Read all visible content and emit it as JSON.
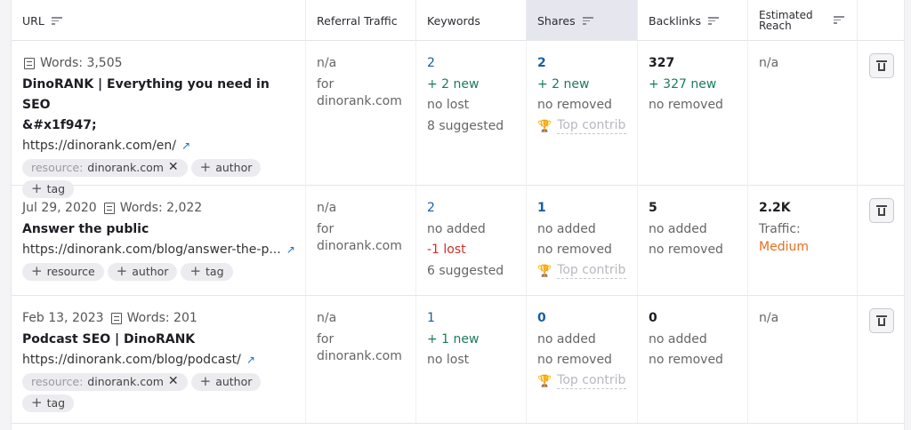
{
  "header": {
    "url": "URL",
    "referral": "Referral Traffic",
    "keywords": "Keywords",
    "shares": "Shares",
    "backlinks": "Backlinks",
    "reach_l1": "Estimated",
    "reach_l2": "Reach"
  },
  "rows": [
    {
      "date": "",
      "words": "Words: 3,505",
      "title": "DinoRANK | Everything you need in SEO",
      "title_l2": "&#x1f947;",
      "url": "https://dinorank.com/en/",
      "referral": [
        "n/a",
        "for",
        "dinorank.com"
      ],
      "keywords": [
        "2",
        "+ 2 new",
        "no lost",
        "8 suggested"
      ],
      "shares": [
        "2",
        "+ 2 new",
        "no removed"
      ],
      "top_contrib": "Top contributors",
      "backlinks": [
        "327",
        "+ 327 new",
        "no removed"
      ],
      "reach": "n/a"
    },
    {
      "date": "Jul 29, 2020",
      "words": "Words: 2,022",
      "title": "Answer the public",
      "url": "https://dinorank.com/blog/answer-the-p...",
      "referral": [
        "n/a",
        "for",
        "dinorank.com"
      ],
      "keywords": [
        "2",
        "no added",
        "-1 lost",
        "6 suggested"
      ],
      "shares": [
        "1",
        "no added",
        "no removed"
      ],
      "top_contrib": "Top contributors",
      "backlinks": [
        "5",
        "no added",
        "no removed"
      ],
      "reach": "2.2K",
      "reach_traffic": "Traffic:",
      "reach_level": "Medium"
    },
    {
      "date": "Feb 13, 2023",
      "words": "Words: 201",
      "title": "Podcast SEO | DinoRANK",
      "url": "https://dinorank.com/blog/podcast/",
      "referral": [
        "n/a",
        "for",
        "dinorank.com"
      ],
      "keywords": [
        "1",
        "+ 1 new",
        "no lost"
      ],
      "shares": [
        "0",
        "no added",
        "no removed"
      ],
      "top_contrib": "Top contributors",
      "backlinks": [
        "0",
        "no added",
        "no removed"
      ],
      "reach": "n/a"
    }
  ],
  "tags": {
    "resource_label": "resource:",
    "resource_value": "dinorank.com",
    "add_resource": "resource",
    "add_author": "author",
    "add_tag": "tag"
  }
}
